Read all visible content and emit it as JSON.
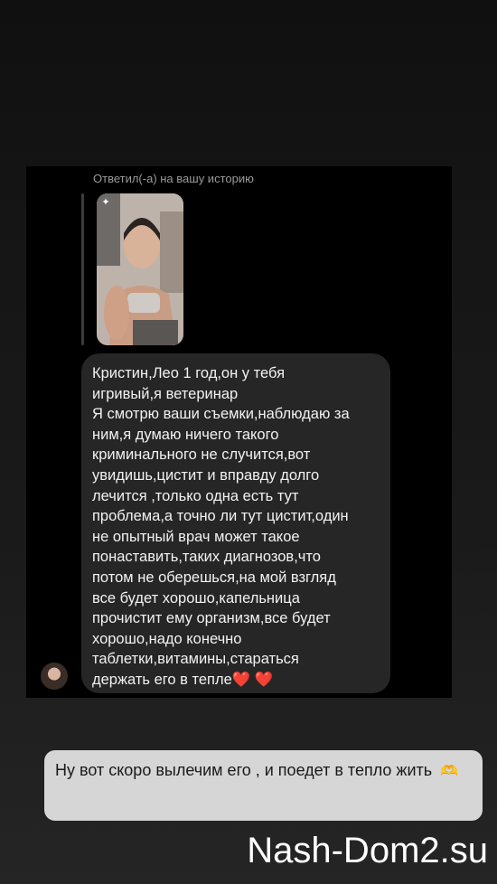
{
  "dm": {
    "reply_label": "Ответил(-а) на вашу историю",
    "message_text": "Кристин,Лео 1 год,он у тебя\nигривый,я ветеринар\nЯ смотрю ваши съемки,наблюдаю за\nним,я думаю ничего такого\nкриминального не случится,вот\nувидишь,цистит и вправду долго\nлечится ,только одна есть тут\nпроблема,а точно ли тут цистит,один\nне опытный врач может такое\nпонаставить,таких диагнозов,что\nпотом не оберешься,на мой взгляд\nвсе будет хорошо,капельница\nпрочистит ему организм,все будет\nхорошо,надо конечно\nтаблетки,витамины,стараться\nдержать его в тепле❤️ ❤️",
    "avatar_icon": "user-avatar"
  },
  "caption": {
    "text": "Ну вот скоро вылечим его , и поедет в тепло жить",
    "emoji_icon": "heart-hands-icon",
    "emoji_glyph": "🫶"
  },
  "watermark": "Nash-Dom2.su",
  "colors": {
    "bubble": "#262626",
    "caption_bg": "#d6d6d6",
    "heart": "#e0243a"
  }
}
